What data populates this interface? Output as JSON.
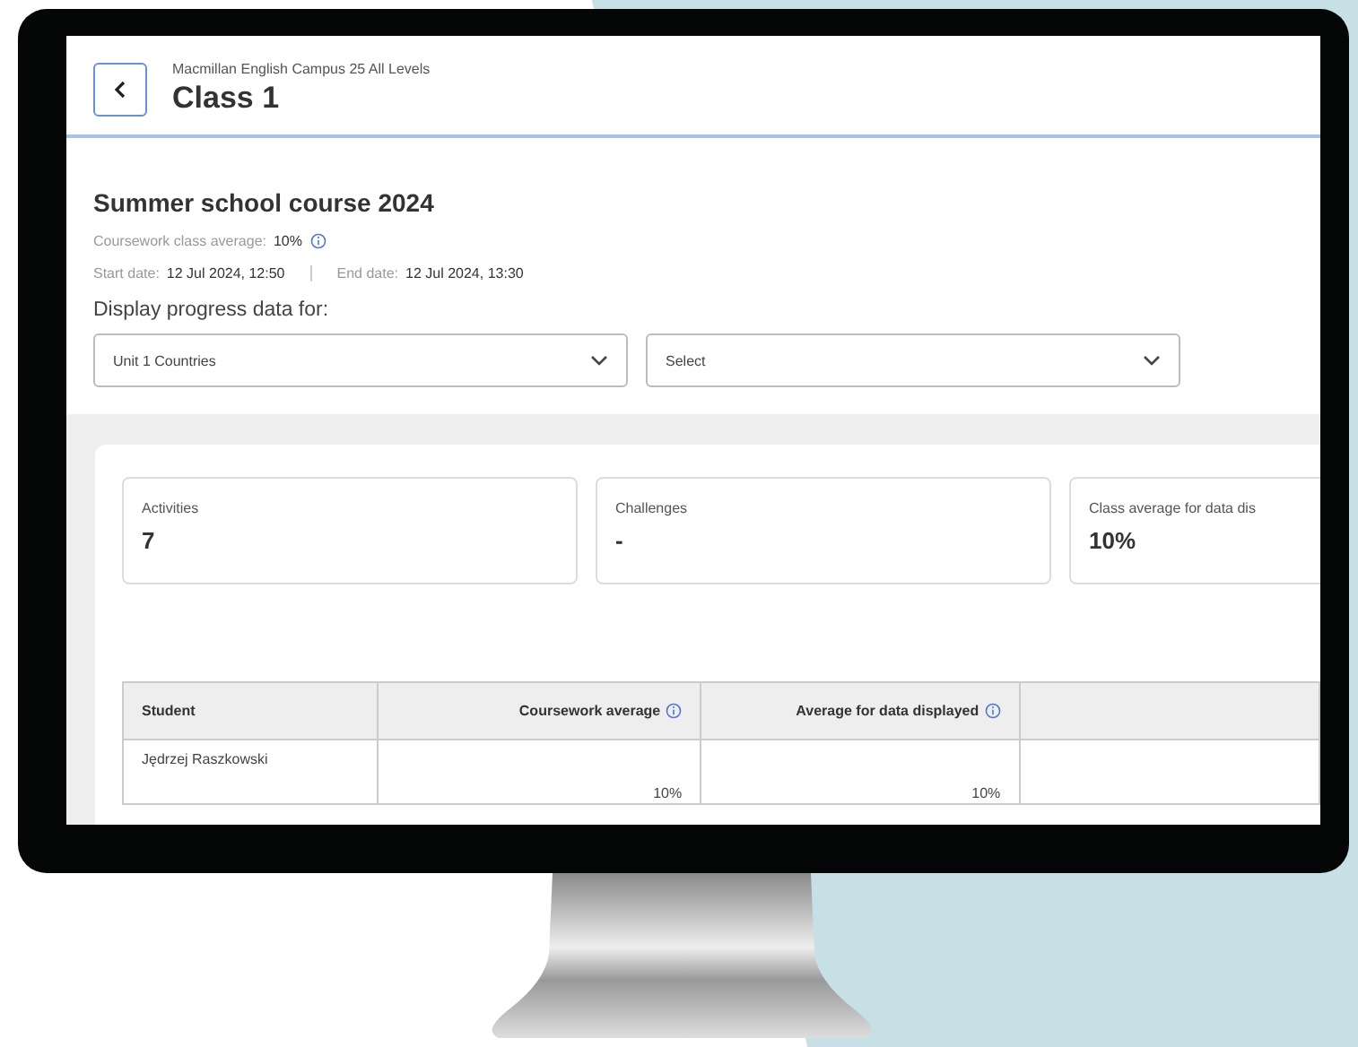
{
  "header": {
    "subtitle": "Macmillan English Campus 25 All Levels",
    "title": "Class 1"
  },
  "course": {
    "title": "Summer school course 2024",
    "average_label": "Coursework class average:",
    "average_value": "10%",
    "start_label": "Start date:",
    "start_value": "12 Jul 2024, 12:50",
    "end_label": "End date:",
    "end_value": "12 Jul 2024, 13:30"
  },
  "filter": {
    "label": "Display progress data for:",
    "dropdowns": [
      {
        "value": "Unit 1 Countries"
      },
      {
        "value": "Select"
      }
    ]
  },
  "cards": [
    {
      "label": "Activities",
      "value": "7"
    },
    {
      "label": "Challenges",
      "value": "-"
    },
    {
      "label": "Class average for data dis",
      "value": "10%"
    }
  ],
  "table": {
    "columns": [
      {
        "label": "Student",
        "info": false
      },
      {
        "label": "Coursework average",
        "info": true
      },
      {
        "label": "Average for data displayed",
        "info": true
      }
    ],
    "rows": [
      {
        "cells": [
          "Jędrzej Raszkowski",
          "10%",
          "10%"
        ]
      }
    ]
  }
}
